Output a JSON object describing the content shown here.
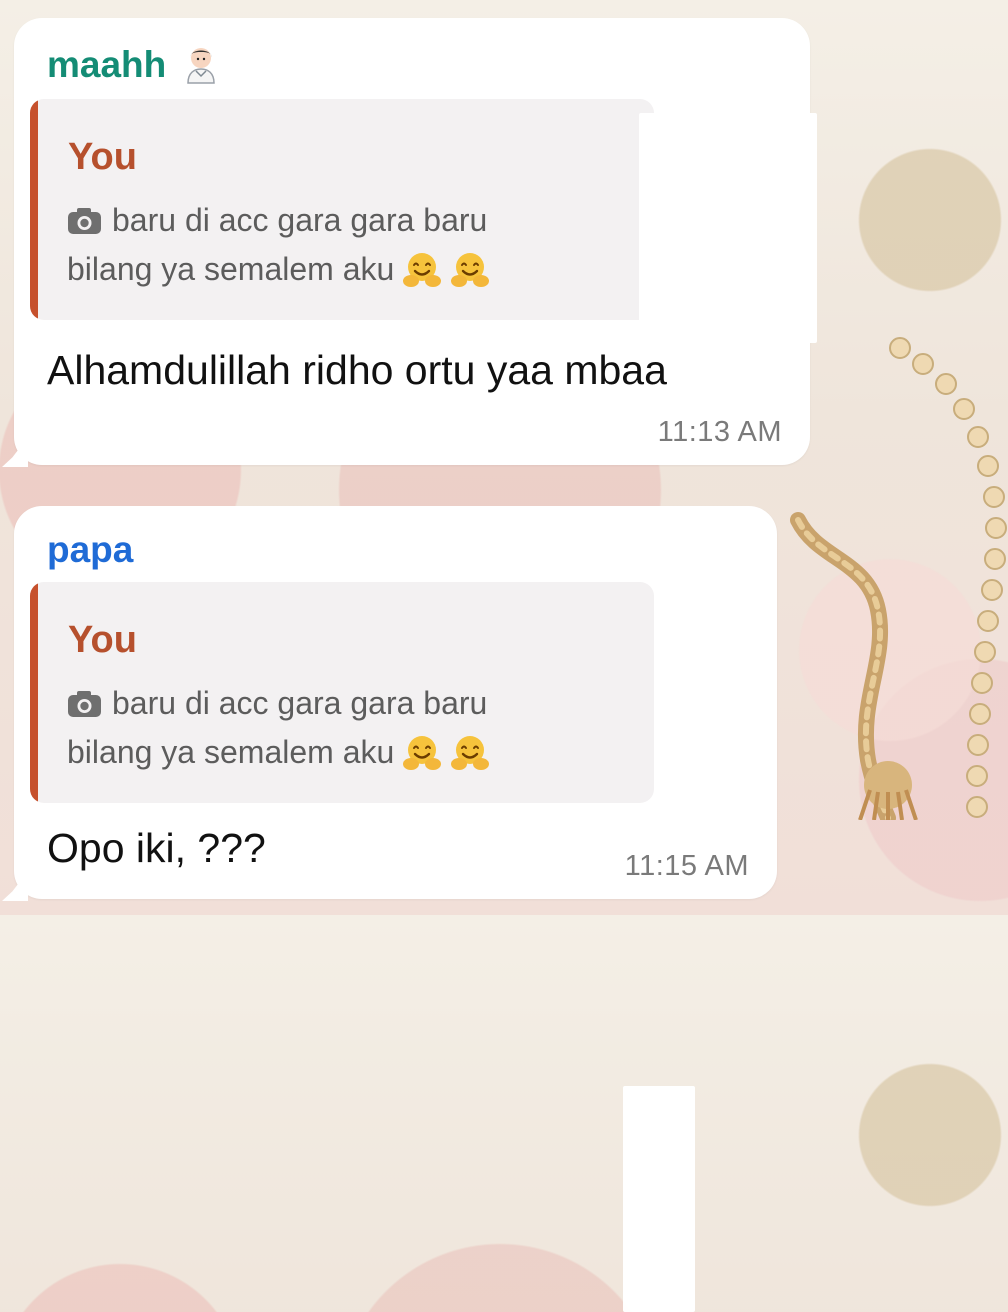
{
  "chat": {
    "messages": [
      {
        "sender": "maahh",
        "sender_icon": "woman-health-worker-emoji-icon",
        "quoted_author": "You",
        "quoted_line_1": "baru di acc gara gara baru",
        "quoted_line_2": "bilang ya semalem aku",
        "quoted_emoji_1": "smiling-face-with-open-hands-icon",
        "quoted_emoji_2": "smiling-face-with-open-hands-icon",
        "text": "Alhamdulillah ridho ortu yaa mbaa",
        "time": "11:13 AM"
      },
      {
        "sender": "papa",
        "quoted_author": "You",
        "quoted_line_1": "baru di acc gara gara baru",
        "quoted_line_2": "bilang ya semalem aku",
        "quoted_emoji_1": "smiling-face-with-open-hands-icon",
        "quoted_emoji_2": "smiling-face-with-open-hands-icon",
        "text": "Opo iki, ???",
        "time": "11:15 AM"
      }
    ]
  },
  "colors": {
    "sender_1": "#148c75",
    "sender_2": "#1f6bd6",
    "quote_bar": "#c6512d",
    "quote_author": "#b6502d",
    "bubble": "#ffffff",
    "quote_bg": "#f3f1f2"
  }
}
